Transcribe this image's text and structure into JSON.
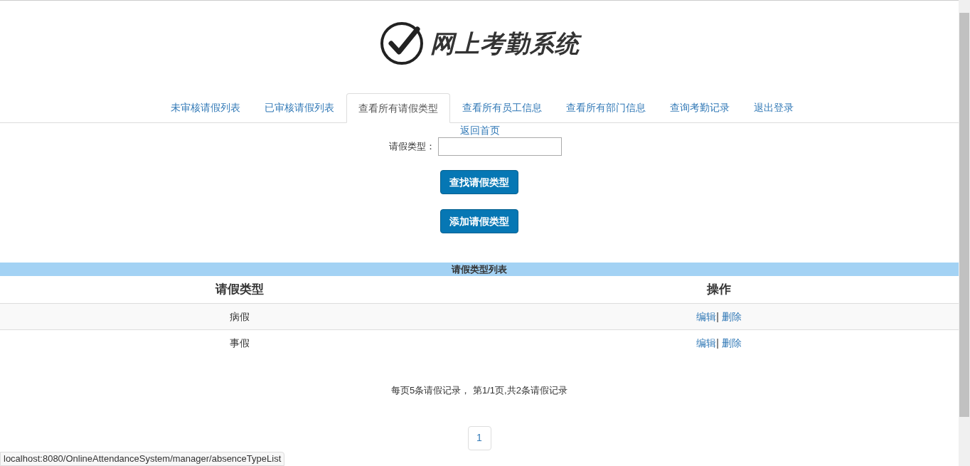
{
  "logo": {
    "title": "网上考勤系统"
  },
  "tabs": [
    {
      "label": "未审核请假列表",
      "selected": false
    },
    {
      "label": "已审核请假列表",
      "selected": false
    },
    {
      "label": "查看所有请假类型",
      "selected": true
    },
    {
      "label": "查看所有员工信息",
      "selected": false
    },
    {
      "label": "查看所有部门信息",
      "selected": false
    },
    {
      "label": "查询考勤记录",
      "selected": false
    },
    {
      "label": "退出登录",
      "selected": false
    }
  ],
  "home_link": "返回首页",
  "search": {
    "label": "请假类型："
  },
  "buttons": [
    "查找请假类型",
    "添加请假类型"
  ],
  "table": {
    "title": "请假类型列表",
    "columns": [
      "请假类型",
      "操作"
    ],
    "rows": [
      {
        "type": "病假",
        "actions": [
          "编辑",
          "删除"
        ],
        "separator": "|"
      },
      {
        "type": "事假",
        "actions": [
          "编辑",
          "删除"
        ],
        "separator": "|"
      }
    ]
  },
  "pagination": {
    "summary": "每页5条请假记录， 第1/1页,共2条请假记录",
    "pages": [
      {
        "label": "1",
        "selected": true
      }
    ]
  },
  "status_url": "localhost:8080/OnlineAttendanceSystem/manager/absenceTypeList"
}
